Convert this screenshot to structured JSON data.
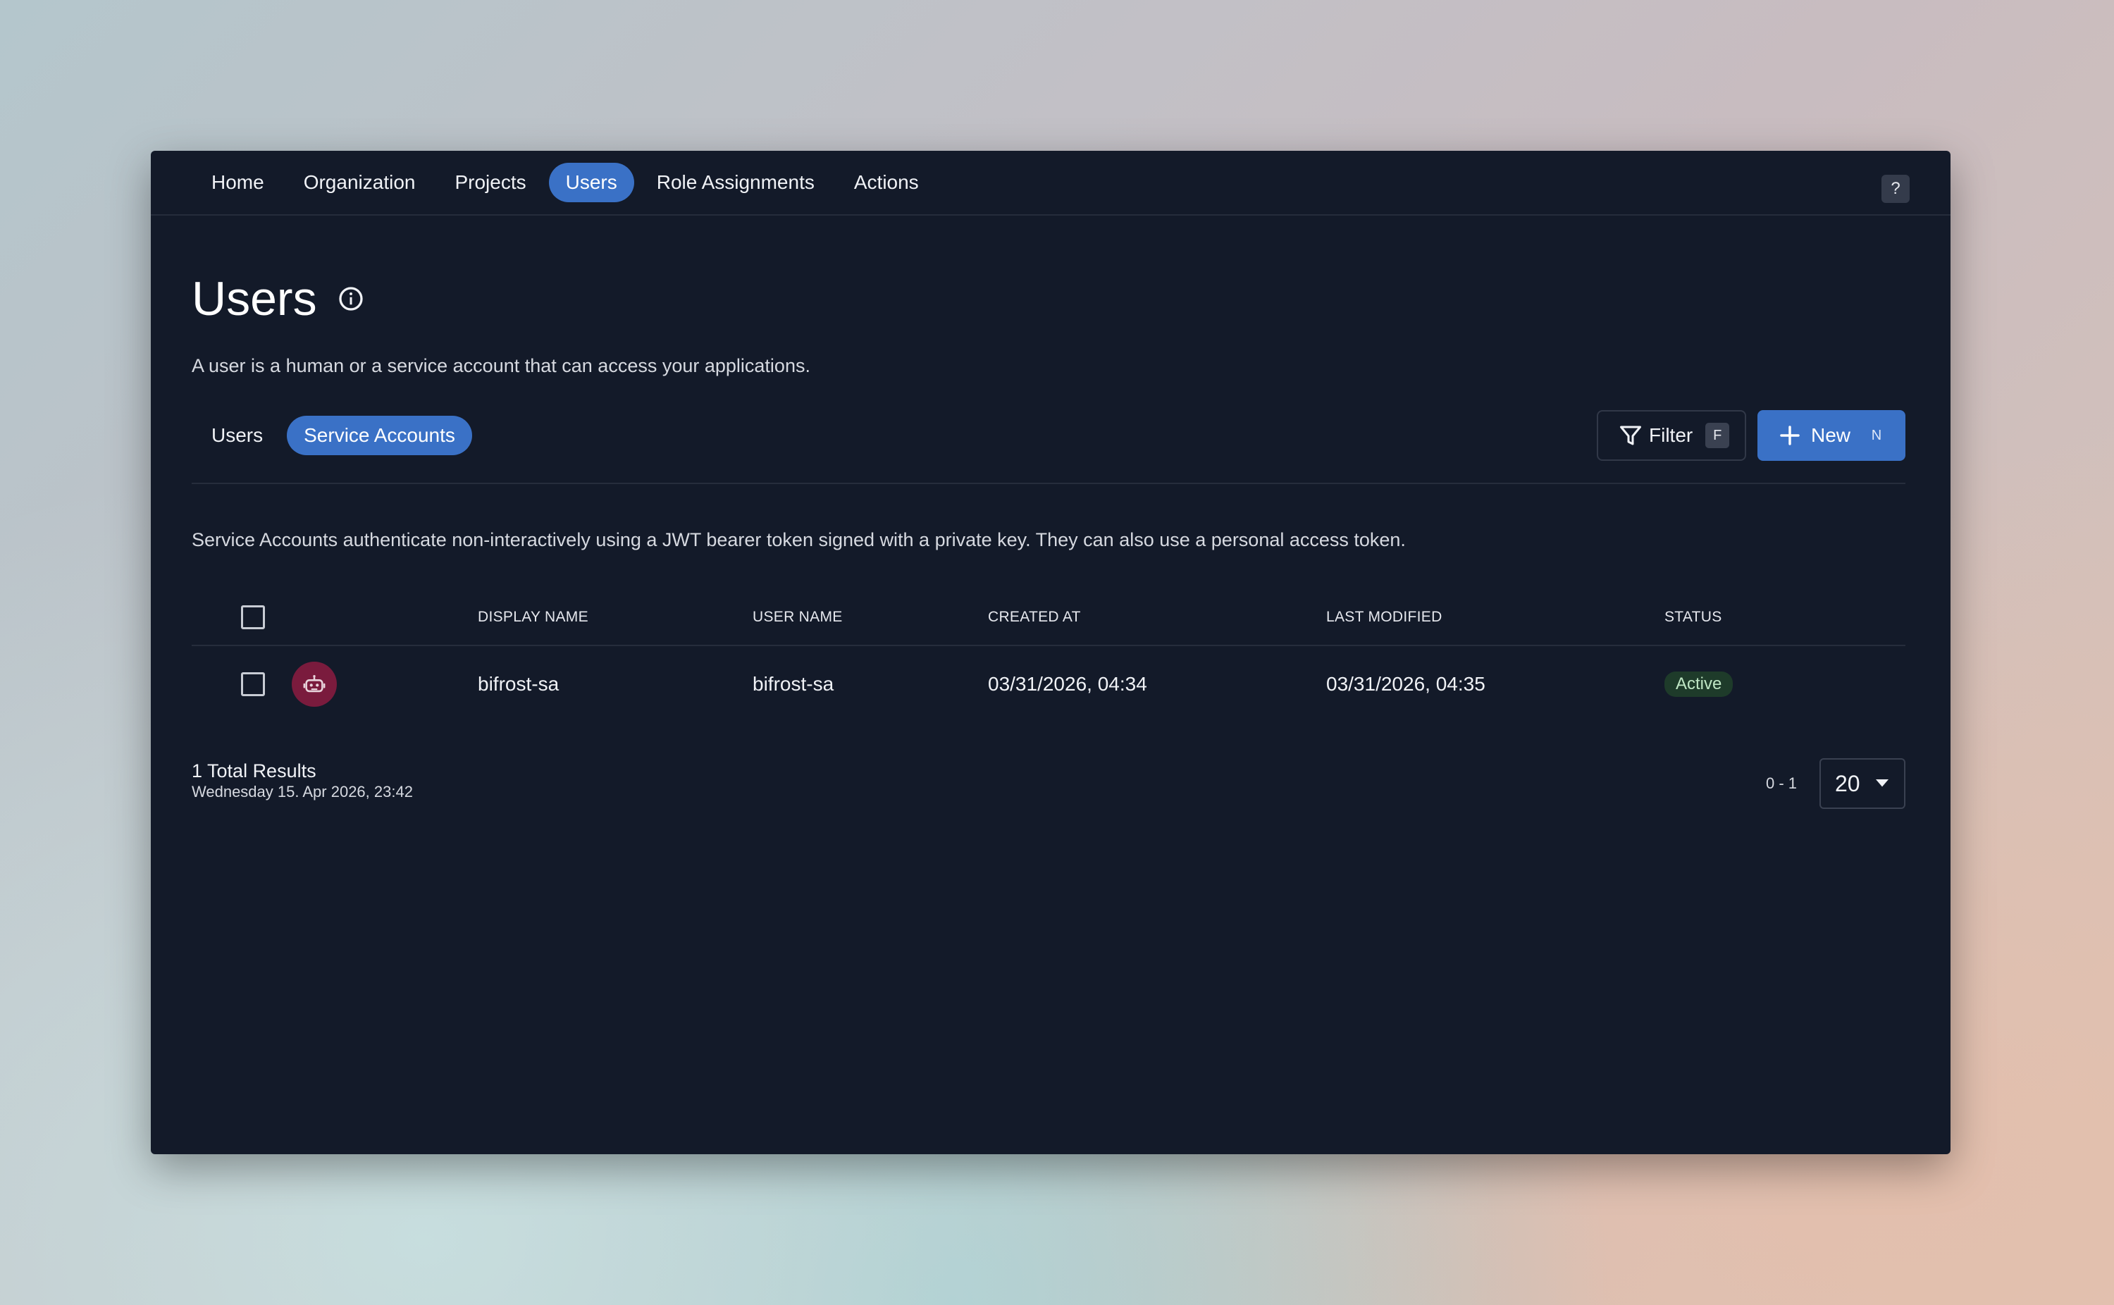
{
  "nav": {
    "items": [
      {
        "label": "Home",
        "active": false
      },
      {
        "label": "Organization",
        "active": false
      },
      {
        "label": "Projects",
        "active": false
      },
      {
        "label": "Users",
        "active": true
      },
      {
        "label": "Role Assignments",
        "active": false
      },
      {
        "label": "Actions",
        "active": false
      }
    ],
    "help_label": "?"
  },
  "page": {
    "title": "Users",
    "subtitle": "A user is a human or a service account that can access your applications.",
    "info_icon": "info-icon"
  },
  "tabs": [
    {
      "label": "Users",
      "active": false
    },
    {
      "label": "Service Accounts",
      "active": true
    }
  ],
  "toolbar": {
    "filter_label": "Filter",
    "filter_shortcut": "F",
    "new_label": "New",
    "new_shortcut": "N"
  },
  "description": "Service Accounts authenticate non-interactively using a JWT bearer token signed with a private key. They can also use a personal access token.",
  "table": {
    "columns": [
      "DISPLAY NAME",
      "USER NAME",
      "CREATED AT",
      "LAST MODIFIED",
      "STATUS"
    ],
    "rows": [
      {
        "avatar_icon": "robot-icon",
        "display_name": "bifrost-sa",
        "user_name": "bifrost-sa",
        "created_at": "03/31/2026, 04:34",
        "last_modified": "03/31/2026, 04:35",
        "status": "Active"
      }
    ]
  },
  "footer": {
    "total": "1 Total Results",
    "timestamp": "Wednesday 15. Apr 2026, 23:42",
    "range": "0 - 1",
    "page_size": "20"
  },
  "colors": {
    "background": "#131a29",
    "accent": "#3a71c6",
    "avatar": "#7a1b3d",
    "status_active_bg": "#1e3b2a"
  }
}
